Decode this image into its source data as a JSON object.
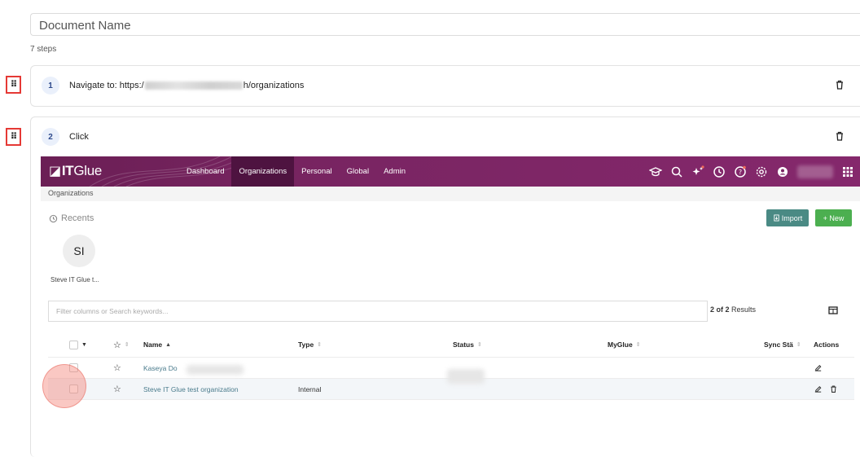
{
  "document": {
    "name": "Document Name",
    "steps_count": "7 steps"
  },
  "steps": [
    {
      "number": "1",
      "text_prefix": "Navigate to: https:/",
      "text_suffix": "h/organizations"
    },
    {
      "number": "2",
      "text": "Click"
    }
  ],
  "itglue": {
    "logo_it": "IT",
    "logo_glue": "Glue",
    "nav": [
      "Dashboard",
      "Organizations",
      "Personal",
      "Global",
      "Admin"
    ],
    "nav_active": "Organizations",
    "breadcrumb": "Organizations",
    "recents_label": "Recents",
    "import_label": "Import",
    "new_label": "+ New",
    "avatar_initials": "SI",
    "avatar_label": "Steve IT Glue t...",
    "filter_placeholder": "Filter columns or Search keywords...",
    "results_count": "2 of 2",
    "results_label": " Results",
    "columns": {
      "name": "Name",
      "type": "Type",
      "status": "Status",
      "myglue": "MyGlue",
      "sync": "Sync Stä",
      "actions": "Actions"
    },
    "rows": [
      {
        "name": "Kaseya Do",
        "type": ""
      },
      {
        "name": "Steve IT Glue test organization",
        "type": "Internal"
      }
    ]
  },
  "colors": {
    "nav_bg": "#7a2563",
    "nav_active": "#4e1340",
    "import_btn": "#4a8a84",
    "new_btn": "#4caf50",
    "highlight": "#e53935"
  }
}
